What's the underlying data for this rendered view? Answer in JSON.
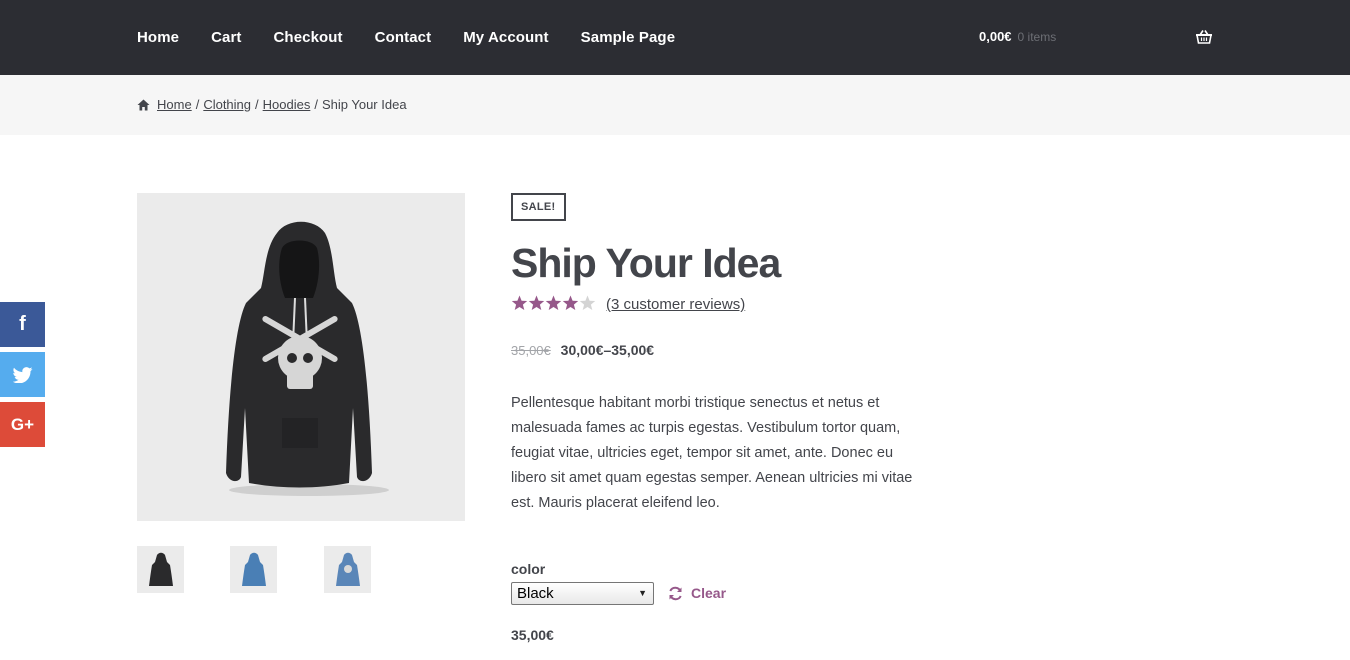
{
  "nav": {
    "items": [
      "Home",
      "Cart",
      "Checkout",
      "Contact",
      "My Account",
      "Sample Page"
    ]
  },
  "mini_cart": {
    "total": "0,00€",
    "count": "0 items"
  },
  "icons": {
    "cart": "basket-icon",
    "home": "home-icon",
    "clear": "refresh-icon"
  },
  "breadcrumb": {
    "home": "Home",
    "category": "Clothing",
    "subcategory": "Hoodies",
    "current": "Ship Your Idea",
    "separator": "/"
  },
  "social": {
    "facebook": "f",
    "twitter": "twitter-bird-icon",
    "google": "G+"
  },
  "product": {
    "badge": "SALE!",
    "title": "Ship Your Idea",
    "rating": 4,
    "rating_max": 5,
    "reviews_link": "(3 customer reviews)",
    "old_price": "35,00€",
    "price_range": "30,00€–35,00€",
    "description": "Pellentesque habitant morbi tristique senectus et netus et malesuada fames ac turpis egestas. Vestibulum tortor quam, feugiat vitae, ultricies eget, tempor sit amet, ante. Donec eu libero sit amet quam egestas semper. Aenean ultricies mi vitae est. Mauris placerat eleifend leo.",
    "attribute_label": "color",
    "attribute_value": "Black",
    "clear_label": "Clear",
    "variation_price": "35,00€"
  },
  "colors": {
    "header": "#2c2d33",
    "accent": "#96588a",
    "facebook": "#3b5998",
    "twitter": "#55acee",
    "google": "#dd4b39"
  }
}
